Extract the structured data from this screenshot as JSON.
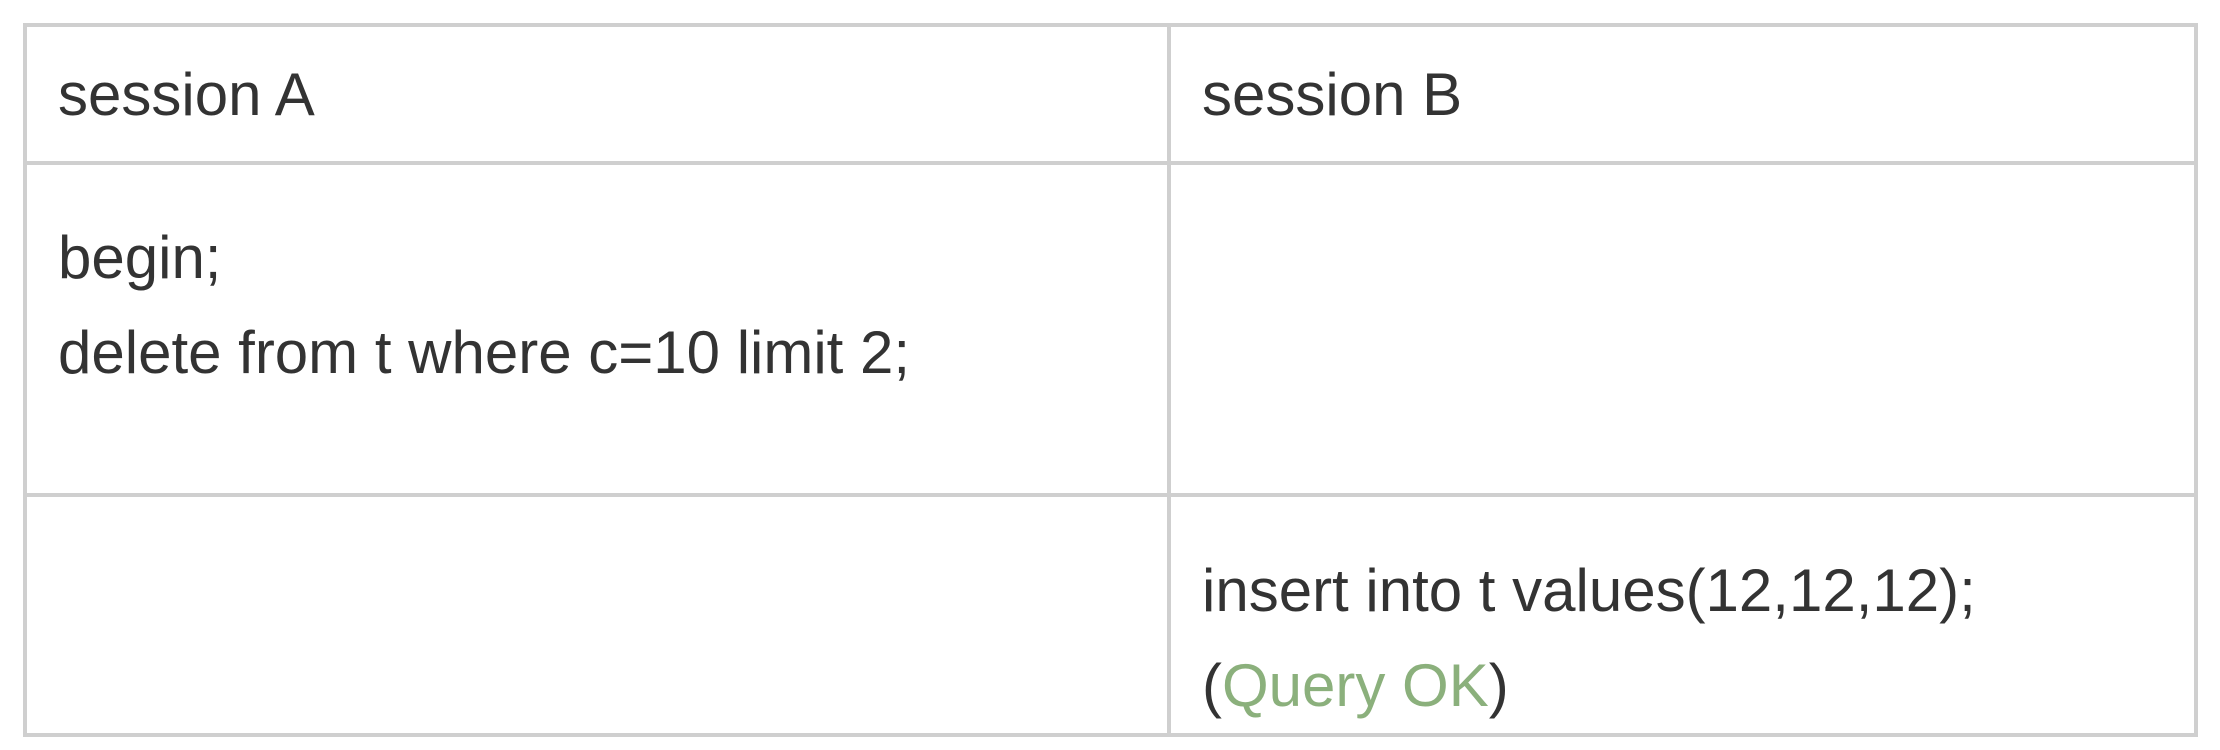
{
  "table": {
    "headers": [
      "session A",
      "session B"
    ],
    "rows": [
      {
        "session_a": [
          "begin;",
          "delete from t where c=10 limit 2;"
        ],
        "session_b": []
      },
      {
        "session_a": [],
        "session_b": {
          "line1": "insert into t values(12,12,12);",
          "line2_open": "(",
          "line2_status": "Query OK",
          "line2_close": ")"
        }
      }
    ],
    "colors": {
      "border": "#cfcfcf",
      "text": "#333333",
      "status_ok": "#8bb07c"
    }
  }
}
